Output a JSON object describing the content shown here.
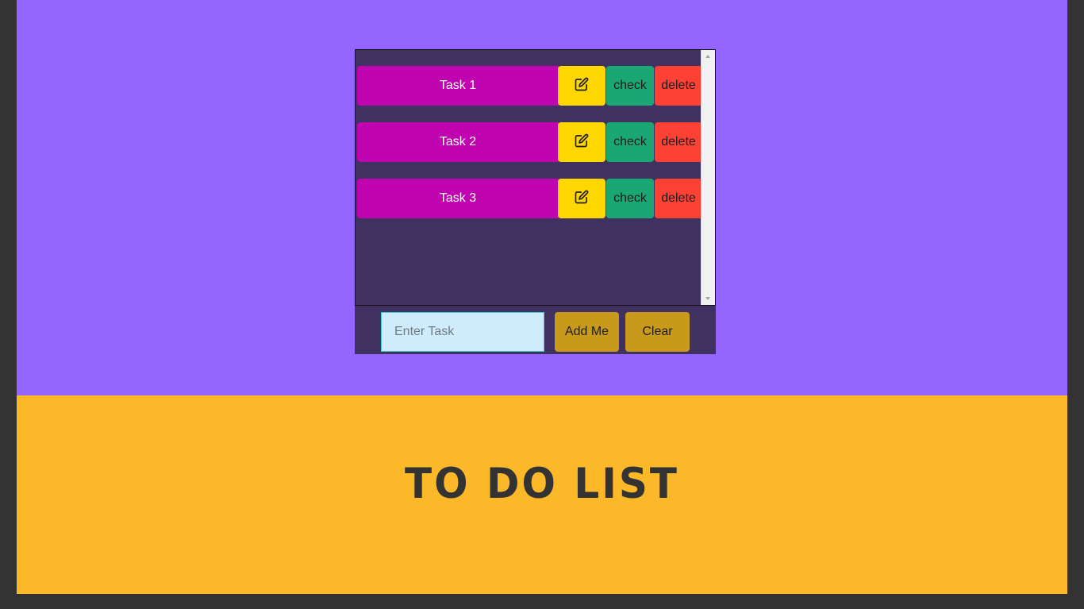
{
  "app": {
    "title": "To Do List"
  },
  "tasks": [
    {
      "name": "Task 1",
      "check_label": "check",
      "delete_label": "delete"
    },
    {
      "name": "Task 2",
      "check_label": "check",
      "delete_label": "delete"
    },
    {
      "name": "Task 3",
      "check_label": "check",
      "delete_label": "delete"
    }
  ],
  "input": {
    "placeholder": "Enter Task",
    "value": ""
  },
  "buttons": {
    "add_label": "Add Me",
    "clear_label": "Clear"
  },
  "icons": {
    "edit": "edit-icon"
  },
  "colors": {
    "top_background": "#9466ff",
    "bottom_background": "#fbb829",
    "list_background": "#3f3260",
    "task_background": "#c004b0",
    "edit_button": "#ffd700",
    "check_button": "#1aa774",
    "delete_button": "#fd4134",
    "action_button": "#c8991a",
    "input_background": "#cfecfc"
  }
}
